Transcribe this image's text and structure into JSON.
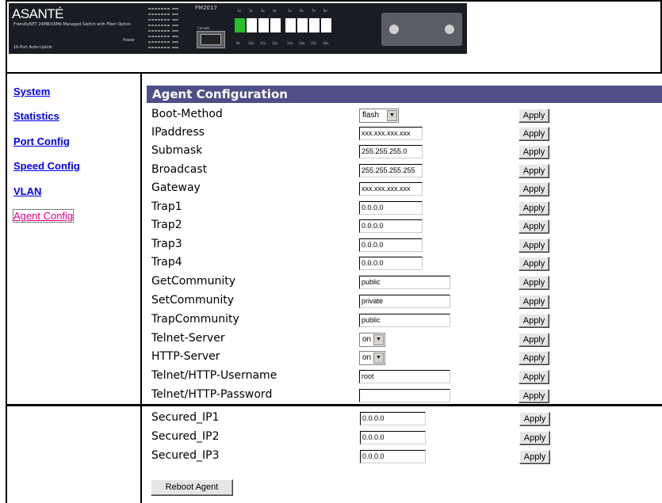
{
  "device": {
    "brand": "ASANTÉ",
    "brand_subtitle": "FriendlyNET 24MB/16Mb Managed Switch with Fiber Option",
    "brand_footer": "16-Port Auto-Uplink",
    "model": "FM2017",
    "power_label": "Power",
    "console_label": "Console",
    "port_numbers_top": [
      "1x",
      "2x",
      "3x",
      "4x",
      "5x",
      "6x",
      "7x",
      "8x"
    ],
    "port_numbers_bottom": [
      "9x",
      "10x",
      "11x",
      "12x",
      "13x",
      "14x",
      "15x",
      "16x"
    ],
    "active_port_color": "#28c028"
  },
  "sidebar": {
    "items": [
      {
        "label": "System"
      },
      {
        "label": "Statistics"
      },
      {
        "label": "Port Config"
      },
      {
        "label": "Speed Config"
      },
      {
        "label": "VLAN"
      },
      {
        "label": "Agent Config"
      }
    ],
    "link_color": "#0000ee",
    "visited_color": "#ee0088"
  },
  "main": {
    "title": "Agent Configuration",
    "apply_label": "Apply",
    "rows": [
      {
        "label": "Boot-Method",
        "type": "select",
        "value": "flash"
      },
      {
        "label": "IPaddress",
        "type": "text",
        "value": "xxx.xxx.xxx.xxx"
      },
      {
        "label": "Submask",
        "type": "text",
        "value": "255.255.255.0"
      },
      {
        "label": "Broadcast",
        "type": "text",
        "value": "255.255.255.255"
      },
      {
        "label": "Gateway",
        "type": "text",
        "value": "xxx.xxx.xxx.xxx"
      },
      {
        "label": "Trap1",
        "type": "text",
        "value": "0.0.0.0"
      },
      {
        "label": "Trap2",
        "type": "text",
        "value": "0.0.0.0"
      },
      {
        "label": "Trap3",
        "type": "text",
        "value": "0.0.0.0"
      },
      {
        "label": "Trap4",
        "type": "text",
        "value": "0.0.0.0"
      },
      {
        "label": "GetCommunity",
        "type": "text",
        "value": "public"
      },
      {
        "label": "SetCommunity",
        "type": "text",
        "value": "private"
      },
      {
        "label": "TrapCommunity",
        "type": "text",
        "value": "public"
      },
      {
        "label": "Telnet-Server",
        "type": "select",
        "value": "on"
      },
      {
        "label": "HTTP-Server",
        "type": "select",
        "value": "on"
      },
      {
        "label": "Telnet/HTTP-Username",
        "type": "text",
        "value": "root"
      },
      {
        "label": "Telnet/HTTP-Password",
        "type": "text",
        "value": ""
      }
    ],
    "secured_rows": [
      {
        "label": "Secured_IP1",
        "value": "0.0.0.0"
      },
      {
        "label": "Secured_IP2",
        "value": "0.0.0.0"
      },
      {
        "label": "Secured_IP3",
        "value": "0.0.0.0"
      }
    ],
    "reboot_label": "Reboot Agent",
    "heading_color": "#4e4f87"
  }
}
